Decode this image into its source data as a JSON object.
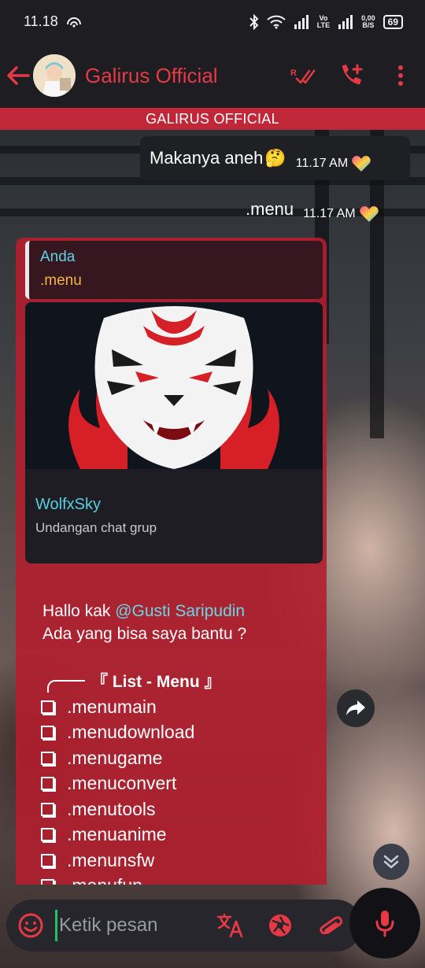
{
  "status_bar": {
    "time": "11.18",
    "volte_label_top": "Vo",
    "volte_label_bottom": "LTE",
    "net_speed_value": "0,00",
    "net_speed_unit": "B/S",
    "battery": "69"
  },
  "app_bar": {
    "contact_name": "Galirus Official",
    "accent_color": "#e63946"
  },
  "group_header": "GALIRUS OFFICIAL",
  "messages": {
    "out_1": {
      "text": "Makanya aneh",
      "emoji": "🤔",
      "time": "11.17 AM"
    },
    "out_2": {
      "text": ".menu",
      "time": "11.17 AM"
    }
  },
  "bot_reply": {
    "quote_author": "Anda",
    "quote_text": ".menu",
    "invite_group_name": "WolfxSky",
    "invite_label": "Undangan chat grup",
    "greeting_prefix": "Hallo kak ",
    "mention": "@Gusti Saripudin",
    "greeting_line2": "Ada yang bisa saya bantu ?",
    "menu_title": "『 List - Menu 』",
    "menu_items": [
      ".menumain",
      ".menudownload",
      ".menugame",
      ".menuconvert",
      ".menutools",
      ".menuanime",
      ".menunsfw",
      ".menufun"
    ]
  },
  "composer": {
    "placeholder": "Ketik pesan"
  },
  "colors": {
    "bubble_red": "#b21e2d",
    "header_red": "#c0283a",
    "mention_cyan": "#69d6e6",
    "quote_name_cyan": "#5fd3e6",
    "quote_text_gold": "#f2b544"
  }
}
